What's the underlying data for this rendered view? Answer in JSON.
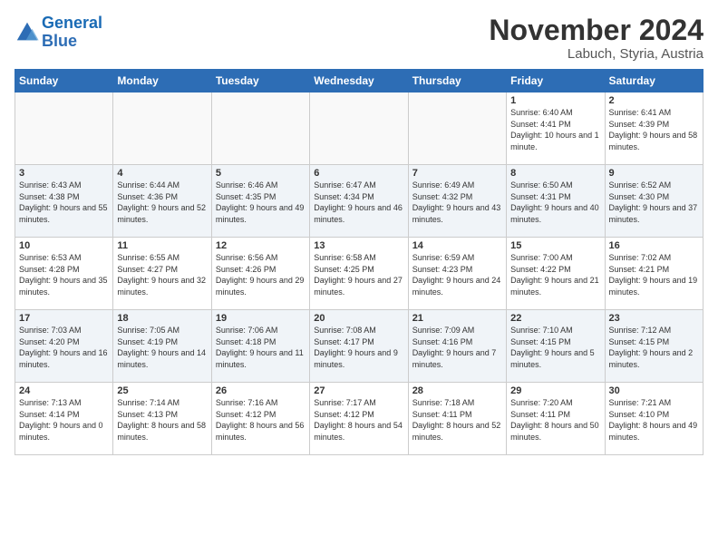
{
  "logo": {
    "line1": "General",
    "line2": "Blue"
  },
  "title": "November 2024",
  "location": "Labuch, Styria, Austria",
  "weekdays": [
    "Sunday",
    "Monday",
    "Tuesday",
    "Wednesday",
    "Thursday",
    "Friday",
    "Saturday"
  ],
  "weeks": [
    [
      {
        "day": "",
        "info": ""
      },
      {
        "day": "",
        "info": ""
      },
      {
        "day": "",
        "info": ""
      },
      {
        "day": "",
        "info": ""
      },
      {
        "day": "",
        "info": ""
      },
      {
        "day": "1",
        "info": "Sunrise: 6:40 AM\nSunset: 4:41 PM\nDaylight: 10 hours and 1 minute."
      },
      {
        "day": "2",
        "info": "Sunrise: 6:41 AM\nSunset: 4:39 PM\nDaylight: 9 hours and 58 minutes."
      }
    ],
    [
      {
        "day": "3",
        "info": "Sunrise: 6:43 AM\nSunset: 4:38 PM\nDaylight: 9 hours and 55 minutes."
      },
      {
        "day": "4",
        "info": "Sunrise: 6:44 AM\nSunset: 4:36 PM\nDaylight: 9 hours and 52 minutes."
      },
      {
        "day": "5",
        "info": "Sunrise: 6:46 AM\nSunset: 4:35 PM\nDaylight: 9 hours and 49 minutes."
      },
      {
        "day": "6",
        "info": "Sunrise: 6:47 AM\nSunset: 4:34 PM\nDaylight: 9 hours and 46 minutes."
      },
      {
        "day": "7",
        "info": "Sunrise: 6:49 AM\nSunset: 4:32 PM\nDaylight: 9 hours and 43 minutes."
      },
      {
        "day": "8",
        "info": "Sunrise: 6:50 AM\nSunset: 4:31 PM\nDaylight: 9 hours and 40 minutes."
      },
      {
        "day": "9",
        "info": "Sunrise: 6:52 AM\nSunset: 4:30 PM\nDaylight: 9 hours and 37 minutes."
      }
    ],
    [
      {
        "day": "10",
        "info": "Sunrise: 6:53 AM\nSunset: 4:28 PM\nDaylight: 9 hours and 35 minutes."
      },
      {
        "day": "11",
        "info": "Sunrise: 6:55 AM\nSunset: 4:27 PM\nDaylight: 9 hours and 32 minutes."
      },
      {
        "day": "12",
        "info": "Sunrise: 6:56 AM\nSunset: 4:26 PM\nDaylight: 9 hours and 29 minutes."
      },
      {
        "day": "13",
        "info": "Sunrise: 6:58 AM\nSunset: 4:25 PM\nDaylight: 9 hours and 27 minutes."
      },
      {
        "day": "14",
        "info": "Sunrise: 6:59 AM\nSunset: 4:23 PM\nDaylight: 9 hours and 24 minutes."
      },
      {
        "day": "15",
        "info": "Sunrise: 7:00 AM\nSunset: 4:22 PM\nDaylight: 9 hours and 21 minutes."
      },
      {
        "day": "16",
        "info": "Sunrise: 7:02 AM\nSunset: 4:21 PM\nDaylight: 9 hours and 19 minutes."
      }
    ],
    [
      {
        "day": "17",
        "info": "Sunrise: 7:03 AM\nSunset: 4:20 PM\nDaylight: 9 hours and 16 minutes."
      },
      {
        "day": "18",
        "info": "Sunrise: 7:05 AM\nSunset: 4:19 PM\nDaylight: 9 hours and 14 minutes."
      },
      {
        "day": "19",
        "info": "Sunrise: 7:06 AM\nSunset: 4:18 PM\nDaylight: 9 hours and 11 minutes."
      },
      {
        "day": "20",
        "info": "Sunrise: 7:08 AM\nSunset: 4:17 PM\nDaylight: 9 hours and 9 minutes."
      },
      {
        "day": "21",
        "info": "Sunrise: 7:09 AM\nSunset: 4:16 PM\nDaylight: 9 hours and 7 minutes."
      },
      {
        "day": "22",
        "info": "Sunrise: 7:10 AM\nSunset: 4:15 PM\nDaylight: 9 hours and 5 minutes."
      },
      {
        "day": "23",
        "info": "Sunrise: 7:12 AM\nSunset: 4:15 PM\nDaylight: 9 hours and 2 minutes."
      }
    ],
    [
      {
        "day": "24",
        "info": "Sunrise: 7:13 AM\nSunset: 4:14 PM\nDaylight: 9 hours and 0 minutes."
      },
      {
        "day": "25",
        "info": "Sunrise: 7:14 AM\nSunset: 4:13 PM\nDaylight: 8 hours and 58 minutes."
      },
      {
        "day": "26",
        "info": "Sunrise: 7:16 AM\nSunset: 4:12 PM\nDaylight: 8 hours and 56 minutes."
      },
      {
        "day": "27",
        "info": "Sunrise: 7:17 AM\nSunset: 4:12 PM\nDaylight: 8 hours and 54 minutes."
      },
      {
        "day": "28",
        "info": "Sunrise: 7:18 AM\nSunset: 4:11 PM\nDaylight: 8 hours and 52 minutes."
      },
      {
        "day": "29",
        "info": "Sunrise: 7:20 AM\nSunset: 4:11 PM\nDaylight: 8 hours and 50 minutes."
      },
      {
        "day": "30",
        "info": "Sunrise: 7:21 AM\nSunset: 4:10 PM\nDaylight: 8 hours and 49 minutes."
      }
    ]
  ]
}
